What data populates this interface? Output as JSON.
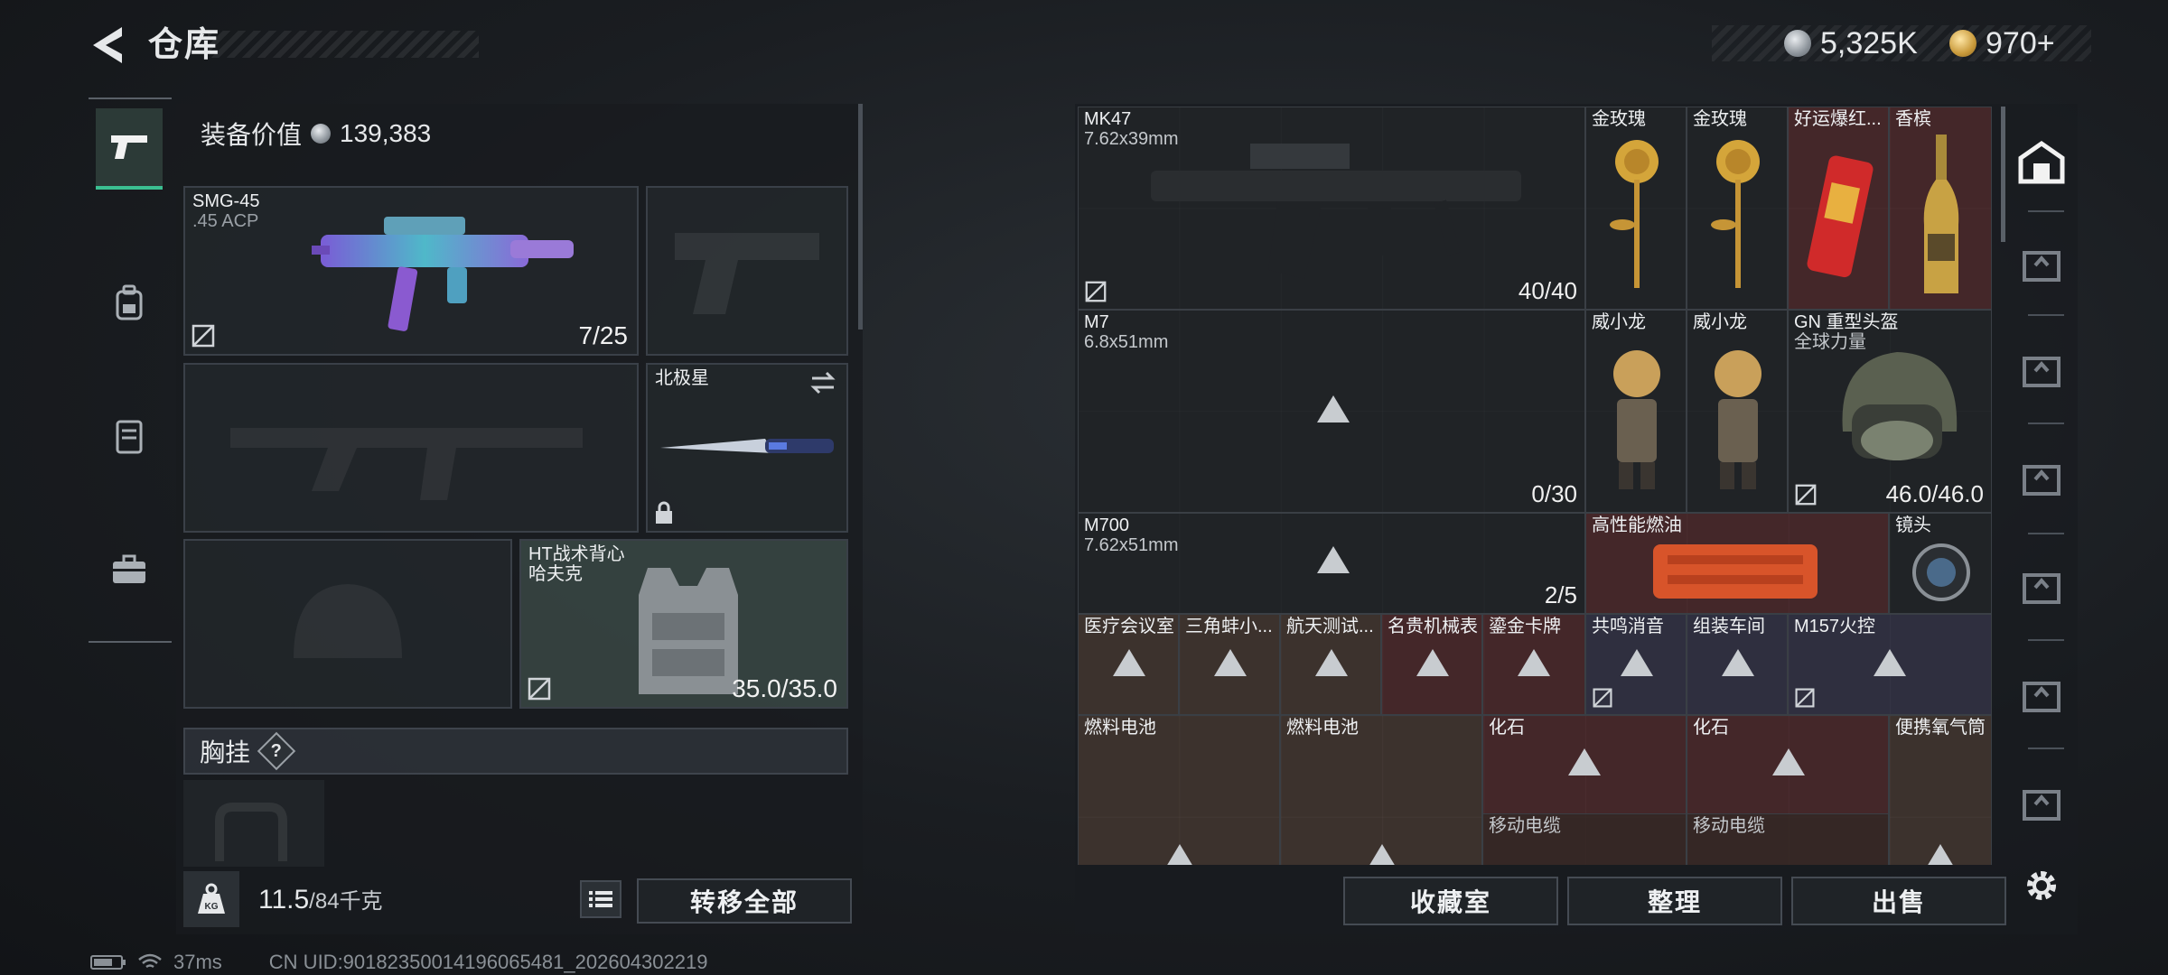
{
  "header": {
    "title": "仓库",
    "currencies": [
      {
        "value": "5,325K",
        "icon": "silver-coin-icon"
      },
      {
        "value": "970+",
        "icon": "gold-coin-icon"
      }
    ]
  },
  "left": {
    "equip_value_label": "装备价值",
    "equip_value": "139,383",
    "primary": {
      "name": "SMG-45",
      "ammo": ".45 ACP",
      "count": "7/25"
    },
    "melee": {
      "name": "北极星"
    },
    "vest": {
      "name": "HT战术背心",
      "sub": "哈夫克",
      "count": "35.0/35.0"
    },
    "chest_label": "胸挂",
    "chest_help": "?",
    "weight_value": "11.5",
    "weight_max": "/84千克",
    "weight_icon_text": "KG",
    "transfer_all": "转移全部"
  },
  "grid": {
    "items": [
      {
        "name": "MK47",
        "sub": "7.62x39mm",
        "count": "40/40"
      },
      {
        "name": "金玫瑰"
      },
      {
        "name": "金玫瑰"
      },
      {
        "name": "好运爆红..."
      },
      {
        "name": "香槟"
      },
      {
        "name": "M7",
        "sub": "6.8x51mm",
        "count": "0/30"
      },
      {
        "name": "威小龙"
      },
      {
        "name": "威小龙"
      },
      {
        "name": "GN 重型头盔",
        "sub": "全球力量",
        "count": "46.0/46.0"
      },
      {
        "name": "M700",
        "sub": "7.62x51mm",
        "count": "2/5"
      },
      {
        "name": "高性能燃油"
      },
      {
        "name": "镜头"
      },
      {
        "name": "医疗会议室"
      },
      {
        "name": "三角蚌小..."
      },
      {
        "name": "航天测试..."
      },
      {
        "name": "名贵机械表"
      },
      {
        "name": "鎏金卡牌"
      },
      {
        "name": "共鸣消音"
      },
      {
        "name": "组装车间"
      },
      {
        "name": "M157火控"
      },
      {
        "name": "燃料电池"
      },
      {
        "name": "燃料电池"
      },
      {
        "name": "化石",
        "sub": "移动电缆"
      },
      {
        "name": "化石",
        "sub": "移动电缆"
      },
      {
        "name": "便携氧气筒"
      }
    ]
  },
  "actions": {
    "collection": "收藏室",
    "sort": "整理",
    "sell": "出售"
  },
  "footer": {
    "ping": "37ms",
    "uid": "CN UID:90182350014196065481_202604302219"
  },
  "colors": {
    "accent_green": "#3bbf91",
    "rarity_red": "#60282a",
    "rarity_purple": "#3a3652",
    "rarity_brown": "#523c32"
  }
}
